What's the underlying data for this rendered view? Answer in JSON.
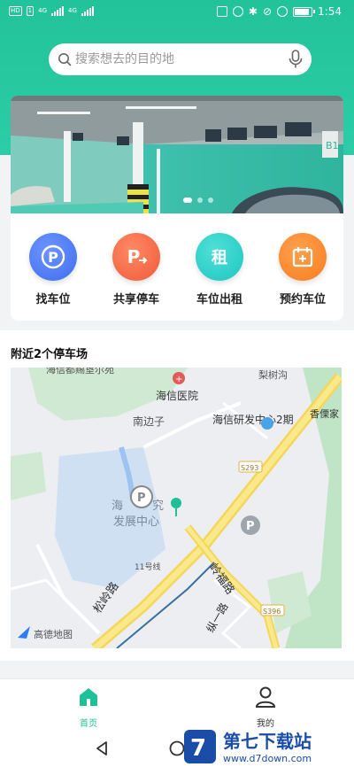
{
  "status_bar": {
    "left_labels": [
      "HD",
      "1",
      "4G",
      "4G"
    ],
    "time": "1:54"
  },
  "search": {
    "placeholder": "搜索想去的目的地"
  },
  "banner": {
    "level_sign": "B1",
    "page_count": 3,
    "active_page": 1
  },
  "shortcuts": [
    {
      "label": "找车位",
      "glyph": "P",
      "color": "#3f6ef0",
      "icon": "parking-icon"
    },
    {
      "label": "共享停车",
      "glyph": "P",
      "color": "#f05a3c",
      "icon": "share-parking-icon"
    },
    {
      "label": "车位出租",
      "glyph": "租",
      "color": "#1ec6c0",
      "icon": "rent-icon"
    },
    {
      "label": "预约车位",
      "glyph": "+",
      "color": "#f77d1f",
      "icon": "calendar-reserve-icon"
    }
  ],
  "nearby": {
    "title": "附近2个停车场"
  },
  "map": {
    "labels": {
      "hospital": "海信医院",
      "south": "南边子",
      "center": "海信研发中心2期",
      "lishugou": "梨树沟",
      "xiangli": "香傈家",
      "campus_a": "海",
      "campus_b": "究",
      "campus_c": "发展中心",
      "songling": "松岭路",
      "xiangfu": "岭福路",
      "yizong": "纵一路",
      "line11": "11号线",
      "s293": "S293",
      "s396": "S396",
      "top_cut": "海信都赐垦尔苑",
      "brand": "高德地图"
    }
  },
  "tabs": [
    {
      "label": "首页",
      "active": true,
      "icon": "home-icon"
    },
    {
      "label": "我的",
      "active": false,
      "icon": "user-icon"
    }
  ],
  "watermark": {
    "title": "第七下载站",
    "url": "www.d7down.com"
  },
  "colors": {
    "brand": "#22c39a",
    "active_tab": "#1fc096"
  }
}
